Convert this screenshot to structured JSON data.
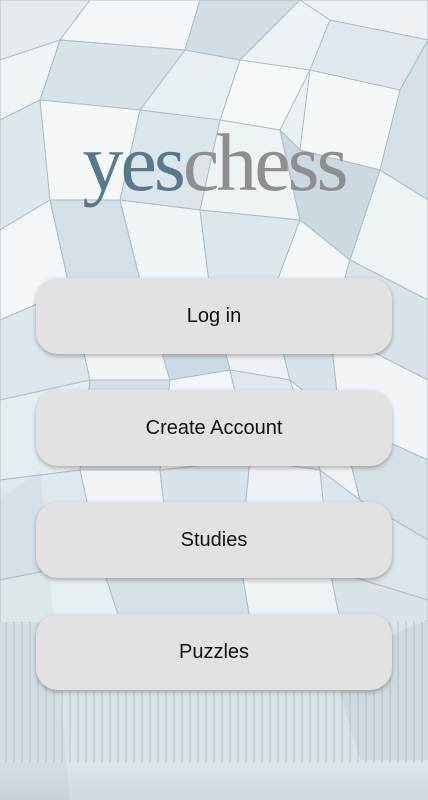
{
  "app": {
    "logo_part1": "yes",
    "logo_part2": "chess"
  },
  "menu": {
    "login_label": "Log in",
    "create_account_label": "Create Account",
    "studies_label": "Studies",
    "puzzles_label": "Puzzles"
  },
  "colors": {
    "logo_yes": "#557a8e",
    "logo_chess": "#8f8f8f",
    "button_bg": "#e2e2e2"
  }
}
